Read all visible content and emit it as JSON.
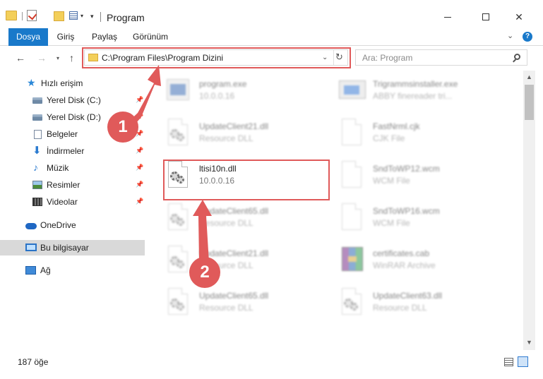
{
  "window": {
    "title": "Program"
  },
  "ribbon": {
    "file_tab": "Dosya",
    "home_tab": "Giriş",
    "share_tab": "Paylaş",
    "view_tab": "Görünüm",
    "help_label": "?"
  },
  "nav": {
    "address_path": "C:\\Program Files\\Program Dizini",
    "search_placeholder": "Ara: Program"
  },
  "sidebar": {
    "items": [
      {
        "label": "Hızlı erişim",
        "icon": "star-icon"
      },
      {
        "label": "Yerel Disk (C:)",
        "icon": "drive-icon",
        "pinned": true
      },
      {
        "label": "Yerel Disk (D:)",
        "icon": "drive-icon",
        "pinned": true
      },
      {
        "label": "Belgeler",
        "icon": "document-icon",
        "pinned": true
      },
      {
        "label": "İndirmeler",
        "icon": "download-icon",
        "pinned": true
      },
      {
        "label": "Müzik",
        "icon": "music-icon",
        "pinned": true
      },
      {
        "label": "Resimler",
        "icon": "picture-icon",
        "pinned": true
      },
      {
        "label": "Videolar",
        "icon": "video-icon",
        "pinned": true
      },
      {
        "label": "OneDrive",
        "icon": "cloud-icon"
      },
      {
        "label": "Bu bilgisayar",
        "icon": "computer-icon",
        "selected": true
      },
      {
        "label": "Ağ",
        "icon": "network-icon"
      }
    ]
  },
  "files": [
    {
      "name": "program.exe",
      "sub": "10.0.0.16",
      "icon": "exe-icon"
    },
    {
      "name": "Trigrammsinstaller.exe",
      "sub": "ABBY finereader tri...",
      "icon": "installer-icon"
    },
    {
      "name": "UpdateClient21.dll",
      "sub": "Resource DLL",
      "icon": "dll-icon"
    },
    {
      "name": "FastNrml.cjk",
      "sub": "CJK File",
      "icon": "file-icon"
    },
    {
      "name": "ltisi10n.dll",
      "sub": "10.0.0.16",
      "icon": "dll-icon",
      "highlighted": true
    },
    {
      "name": "SndToWP12.wcm",
      "sub": "WCM File",
      "icon": "file-icon"
    },
    {
      "name": "UpdateClient65.dll",
      "sub": "Resource DLL",
      "icon": "dll-icon"
    },
    {
      "name": "SndToWP16.wcm",
      "sub": "WCM File",
      "icon": "file-icon"
    },
    {
      "name": "UpdateClient21.dll",
      "sub": "Resource DLL",
      "icon": "dll-icon"
    },
    {
      "name": "certificates.cab",
      "sub": "WinRAR Archive",
      "icon": "archive-icon"
    },
    {
      "name": "UpdateClient65.dll",
      "sub": "Resource DLL",
      "icon": "dll-icon"
    },
    {
      "name": "UpdateClient63.dll",
      "sub": "Resource DLL",
      "icon": "dll-icon"
    }
  ],
  "status": {
    "item_count": "187 öğe"
  },
  "annotations": {
    "step1": "1",
    "step2": "2",
    "color": "#e05a5a"
  }
}
